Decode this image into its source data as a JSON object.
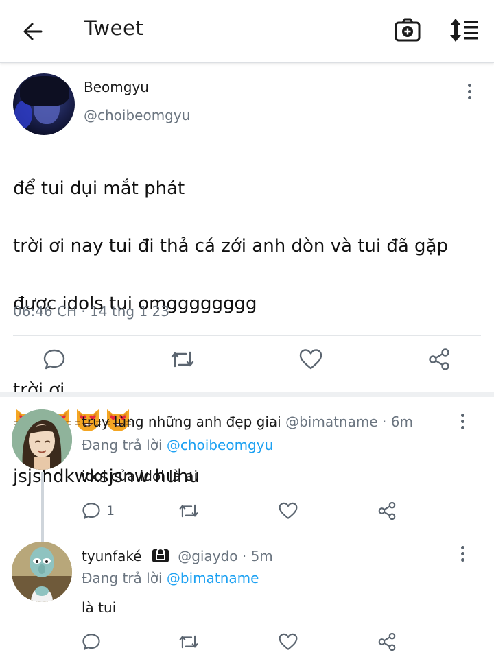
{
  "header": {
    "title": "Tweet",
    "back_icon": "arrow-left-icon",
    "camera_icon": "camera-plus-icon",
    "sort_icon": "sort-lines-icon"
  },
  "tweet": {
    "author_name": "Beomgyu",
    "author_handle": "@choibeomgyu",
    "lines": [
      "để tui dụi mắt phát",
      "trời ơi nay tui đi thả cá zới anh dòn và tui đã gặp",
      "được idols tui omgggggggg",
      "trời ơi",
      "jsjshdkwksjsnw huhu"
    ],
    "emoji": "heart-eyes-cat-emoji",
    "emoji_count": 4,
    "timestamp": "06:46 CH · 14 thg 1 23",
    "actions": [
      "reply-icon",
      "retweet-icon",
      "like-icon",
      "share-icon"
    ]
  },
  "replies": [
    {
      "name": "truy lùng những anh đẹp giai",
      "handle": "@bimatname · 6m",
      "replying_prefix": "Đang trả lời",
      "replying_to": "@choibeomgyu",
      "text": "idol của idol là ai",
      "reply_count": "1"
    },
    {
      "name": "tyunfaké",
      "handle": "@giaydo · 5m",
      "locked": true,
      "replying_prefix": "Đang trả lời",
      "replying_to": "@bimatname",
      "text": "là tui",
      "reply_count": ""
    }
  ],
  "colors": {
    "link": "#1da1f2",
    "muted": "#6b7580",
    "icon": "#5b6570"
  }
}
